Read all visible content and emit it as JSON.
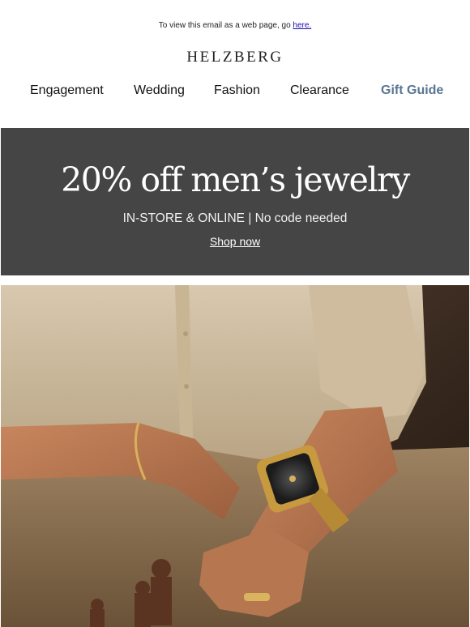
{
  "preheader": {
    "text": "To view this email as a web page, go ",
    "link_label": "here."
  },
  "brand": {
    "logo_text": "HELZBERG"
  },
  "nav": {
    "items": [
      {
        "label": "Engagement"
      },
      {
        "label": "Wedding"
      },
      {
        "label": "Fashion"
      },
      {
        "label": "Clearance"
      },
      {
        "label": "Gift Guide"
      }
    ]
  },
  "banner": {
    "headline": "20% off men’s jewelry",
    "subline": "IN-STORE & ONLINE  |  No code needed",
    "cta_label": "Shop now",
    "background": "#454545"
  },
  "hero": {
    "alt_subject": "man-wearing-gold-watch-ring-bracelet-at-chessboard"
  },
  "colors": {
    "gift_guide": "#5a7593",
    "link": "#1a0dab"
  }
}
